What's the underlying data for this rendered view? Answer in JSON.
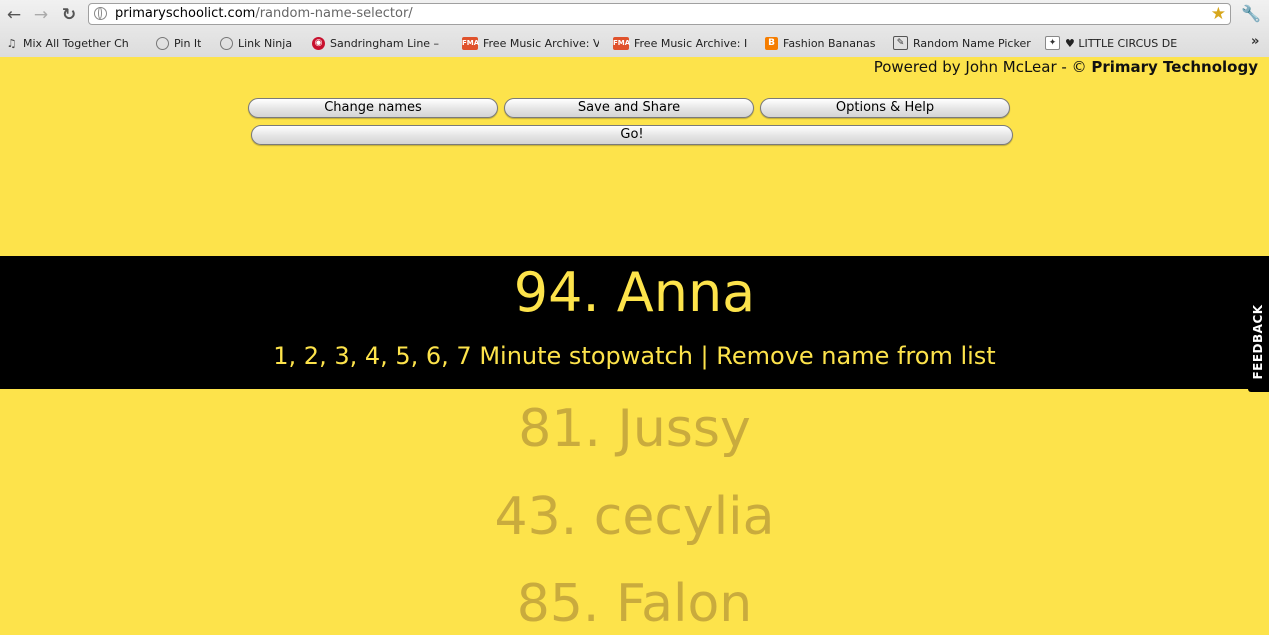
{
  "browser": {
    "url_host": "primaryschoolict.com",
    "url_path": "/random-name-selector/",
    "back_glyph": "←",
    "forward_glyph": "→",
    "reload_glyph": "↻",
    "star_glyph": "★",
    "wrench_glyph": "🔧",
    "more_glyph": "»",
    "bookmarks": [
      {
        "label": "Mix All Together Ch",
        "icon": "headphones-icon"
      },
      {
        "label": "Pin It",
        "icon": "globe-icon"
      },
      {
        "label": "Link Ninja",
        "icon": "globe-icon"
      },
      {
        "label": "Sandringham Line –",
        "icon": "train-icon"
      },
      {
        "label": "Free Music Archive: V",
        "icon": "fma-icon"
      },
      {
        "label": "Free Music Archive: I",
        "icon": "fma-icon"
      },
      {
        "label": "Fashion Bananas",
        "icon": "blogger-icon"
      },
      {
        "label": "Random Name Picker",
        "icon": "picker-icon"
      },
      {
        "label": "♥ LITTLE CIRCUS DE",
        "icon": "circus-icon"
      }
    ]
  },
  "page": {
    "powered_prefix": "Powered by John McLear - © ",
    "powered_brand": "Primary Technology",
    "buttons": {
      "change_names": "Change names",
      "save_share": "Save and Share",
      "options_help": "Options & Help",
      "go": "Go!"
    },
    "winner": "94. Anna",
    "links": {
      "stopwatch": "1, 2, 3, 4, 5, 6, 7 Minute stopwatch",
      "separator": " | ",
      "remove": "Remove name from list"
    },
    "history": [
      "81. Jussy",
      "43. cecylia",
      "85. Falon"
    ],
    "feedback": "FEEDBACK"
  },
  "colors": {
    "background": "#fde34b",
    "band": "#000000",
    "winner_text": "#fde34b",
    "history_text": "#c9ab3d"
  }
}
